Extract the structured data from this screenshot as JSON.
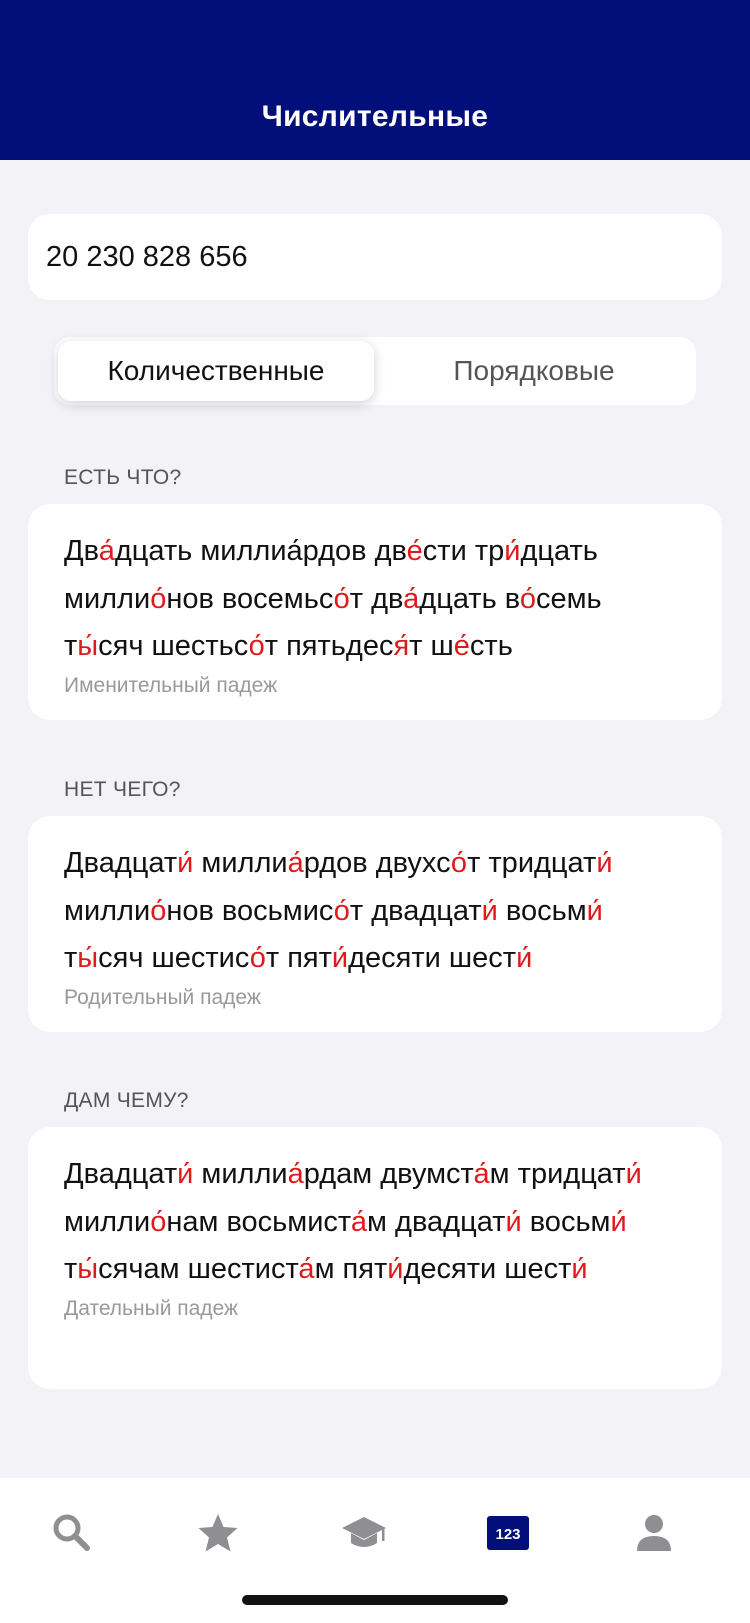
{
  "header": {
    "title": "Числительные"
  },
  "number_input": {
    "value": "20 230 828 656"
  },
  "segments": {
    "cardinal": "Количественные",
    "ordinal": "Порядковые",
    "selected": "cardinal"
  },
  "sections": [
    {
      "label": "ЕСТЬ ЧТО?",
      "text_parts": [
        {
          "t": "Дв"
        },
        {
          "t": "а́",
          "s": true
        },
        {
          "t": "дцать миллиа"
        },
        {
          "t": "́",
          "s": true
        },
        {
          "t": "рдов дв"
        },
        {
          "t": "е́",
          "s": true
        },
        {
          "t": "сти тр"
        },
        {
          "t": "и́",
          "s": true
        },
        {
          "t": "дцать милли"
        },
        {
          "t": "о́",
          "s": true
        },
        {
          "t": "нов восемьс"
        },
        {
          "t": "о́",
          "s": true
        },
        {
          "t": "т дв"
        },
        {
          "t": "а́",
          "s": true
        },
        {
          "t": "дцать в"
        },
        {
          "t": "о́",
          "s": true
        },
        {
          "t": "семь т"
        },
        {
          "t": "ы́",
          "s": true
        },
        {
          "t": "сяч шестьс"
        },
        {
          "t": "о́",
          "s": true
        },
        {
          "t": "т пятьдес"
        },
        {
          "t": "я́",
          "s": true
        },
        {
          "t": "т ш"
        },
        {
          "t": "е́",
          "s": true
        },
        {
          "t": "сть"
        }
      ],
      "case": "Именительный падеж"
    },
    {
      "label": "НЕТ ЧЕГО?",
      "text_parts": [
        {
          "t": "Двадцат"
        },
        {
          "t": "и́",
          "s": true
        },
        {
          "t": " милли"
        },
        {
          "t": "а́",
          "s": true
        },
        {
          "t": "рдов двухс"
        },
        {
          "t": "о́",
          "s": true
        },
        {
          "t": "т тридцат"
        },
        {
          "t": "и́",
          "s": true
        },
        {
          "t": " милли"
        },
        {
          "t": "о́",
          "s": true
        },
        {
          "t": "нов восьмис"
        },
        {
          "t": "о́",
          "s": true
        },
        {
          "t": "т двадцат"
        },
        {
          "t": "и́",
          "s": true
        },
        {
          "t": " восьм"
        },
        {
          "t": "и́",
          "s": true
        },
        {
          "t": " т"
        },
        {
          "t": "ы́",
          "s": true
        },
        {
          "t": "сяч шестис"
        },
        {
          "t": "о́",
          "s": true
        },
        {
          "t": "т пят"
        },
        {
          "t": "и́",
          "s": true
        },
        {
          "t": "десяти шест"
        },
        {
          "t": "и́",
          "s": true
        }
      ],
      "case": "Родительный падеж"
    },
    {
      "label": "ДАМ ЧЕМУ?",
      "text_parts": [
        {
          "t": "Двадцат"
        },
        {
          "t": "и́",
          "s": true
        },
        {
          "t": " милли"
        },
        {
          "t": "а́",
          "s": true
        },
        {
          "t": "рдам двумст"
        },
        {
          "t": "а́",
          "s": true
        },
        {
          "t": "м тридцат"
        },
        {
          "t": "и́",
          "s": true
        },
        {
          "t": " милли"
        },
        {
          "t": "о́",
          "s": true
        },
        {
          "t": "нам восьмист"
        },
        {
          "t": "а́",
          "s": true
        },
        {
          "t": "м двадцат"
        },
        {
          "t": "и́",
          "s": true
        },
        {
          "t": " восьм"
        },
        {
          "t": "и́",
          "s": true
        },
        {
          "t": " т"
        },
        {
          "t": "ы́",
          "s": true
        },
        {
          "t": "сячам шестист"
        },
        {
          "t": "а́",
          "s": true
        },
        {
          "t": "м пят"
        },
        {
          "t": "и́",
          "s": true
        },
        {
          "t": "десяти шест"
        },
        {
          "t": "и́",
          "s": true
        }
      ],
      "case": "Дательный падеж"
    }
  ],
  "tabbar": {
    "items": [
      {
        "icon": "search-icon"
      },
      {
        "icon": "star-icon"
      },
      {
        "icon": "graduation-cap-icon"
      },
      {
        "icon": "numbers-icon",
        "label": "123",
        "active": true
      },
      {
        "icon": "profile-icon"
      }
    ]
  },
  "colors": {
    "header": "#020e7a",
    "stress": "#e0191c",
    "active_tab": "#020e7a",
    "inactive_tab": "#8e8e93"
  }
}
